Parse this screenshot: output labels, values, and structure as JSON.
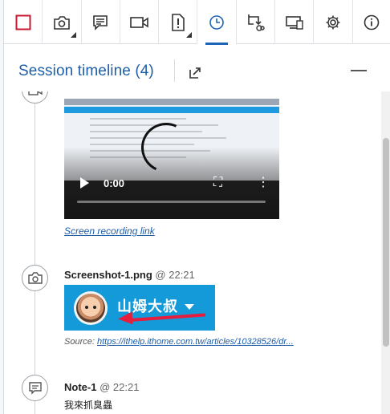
{
  "toolbar": {
    "items": [
      {
        "name": "stop-record-icon"
      },
      {
        "name": "camera-icon"
      },
      {
        "name": "note-icon"
      },
      {
        "name": "video-icon"
      },
      {
        "name": "issue-icon"
      },
      {
        "name": "timeline-icon",
        "active": true
      },
      {
        "name": "sync-icon"
      },
      {
        "name": "device-icon"
      },
      {
        "name": "settings-icon"
      },
      {
        "name": "info-icon"
      }
    ],
    "accent_color": "#1e64b4"
  },
  "header": {
    "title": "Session timeline (4)"
  },
  "timeline": {
    "video": {
      "time": "0:00",
      "link_text": "Screen recording link"
    },
    "screenshot": {
      "title": "Screenshot-1.png",
      "time": "@ 22:21",
      "image_text": "山姆大叔",
      "source_label": "Source:",
      "source_url": "https://ithelp.ithome.com.tw/articles/10328526/dr..."
    },
    "note": {
      "title": "Note-1",
      "time": "@ 22:21",
      "text": "我來抓臭蟲"
    }
  }
}
